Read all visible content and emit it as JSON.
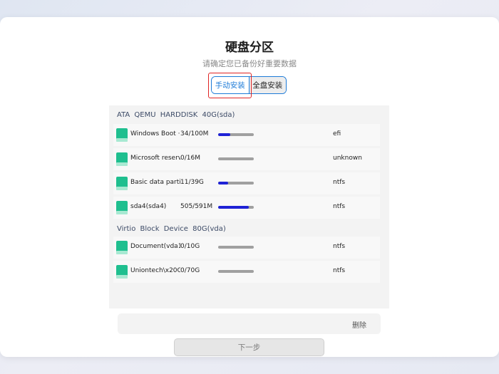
{
  "page": {
    "title": "硬盘分区",
    "subtitle": "请确定您已备份好重要数据"
  },
  "tabs": [
    {
      "label": "手动安装",
      "active": true
    },
    {
      "label": "全盘安装",
      "active": false
    }
  ],
  "disks": [
    {
      "header": "ATA QEMU HARDDISK 40G(sda)",
      "partitions": [
        {
          "name": "Windows Boot ···",
          "size": "34/100M",
          "usage": 0.34,
          "fs": "efi"
        },
        {
          "name": "Microsoft reserv···",
          "size": "0/16M",
          "usage": 0.0,
          "fs": "unknown"
        },
        {
          "name": "Basic data parti···",
          "size": "11/39G",
          "usage": 0.28,
          "fs": "ntfs"
        },
        {
          "name": "sda4(sda4)",
          "size": "505/591M",
          "usage": 0.85,
          "fs": "ntfs"
        }
      ]
    },
    {
      "header": "Virtio Block Device 80G(vda)",
      "partitions": [
        {
          "name": "Document(vda1)",
          "size": "0/10G",
          "usage": 0.0,
          "fs": "ntfs"
        },
        {
          "name": "Uniontech\\x20O···",
          "size": "0/70G",
          "usage": 0.0,
          "fs": "ntfs"
        }
      ]
    }
  ],
  "actions": {
    "delete_label": "删除",
    "next_label": "下一步"
  },
  "colors": {
    "accent": "#1d7bd8",
    "usage_fill": "#1f22d6",
    "highlight": "#e02424",
    "partition_icon": "#1fbf8f"
  },
  "icons": {
    "partition": "green-disk-icon"
  }
}
